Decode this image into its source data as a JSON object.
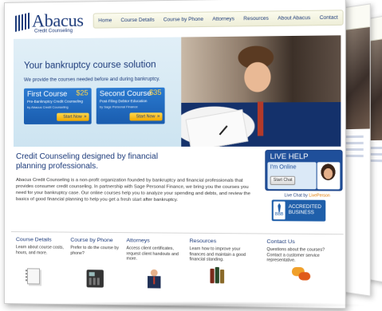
{
  "brand": {
    "name": "Abacus",
    "tagline": "Credit Counseling"
  },
  "nav": {
    "items": [
      "Home",
      "Course Details",
      "Course by Phone",
      "Attorneys",
      "Resources",
      "About Abacus",
      "Contact"
    ]
  },
  "hero": {
    "title": "Your bankruptcy course solution",
    "subtitle": "We provide the courses needed before and during bankruptcy.",
    "courses": [
      {
        "name": "First Course",
        "price": "$25",
        "desc": "Pre-Bankruptcy Credit Counseling",
        "by": "by Abacus Credit Counseling",
        "button": "Start Now"
      },
      {
        "name": "Second Course",
        "price": "$35",
        "desc": "Post-Filing Debtor Education",
        "by": "by Sage Personal Finance",
        "button": "Start Now"
      }
    ]
  },
  "main": {
    "title": "Credit Counseling designed by financial planning professionals.",
    "body": "Abacus Credit Counseling is a non-profit organization founded by bankruptcy and financial professionals that provides consumer credit counseling. In partnership with Sage Personal Finance, we bring you the courses you need for your bankruptcy case. Our online courses help you to analyze your spending and debts, and review the basics of good financial planning to help you get a fresh start after bankruptcy."
  },
  "live_help": {
    "title": "LIVE HELP",
    "status": "I'm Online",
    "chat_button": "Start Chat",
    "powered_prefix": "Live Chat by",
    "powered_brand": "LivePerson"
  },
  "bbb": {
    "logo": "BBB",
    "line1": "ACCREDITED",
    "line2": "BUSINESS"
  },
  "features": [
    {
      "title": "Course Details",
      "desc": "Learn about course costs, hours, and more.",
      "icon": "document-icon"
    },
    {
      "title": "Course by Phone",
      "desc": "Prefer to do the course by phone?",
      "icon": "phone-icon"
    },
    {
      "title": "Attorneys",
      "desc": "Access client certificates, request client handouts and more.",
      "icon": "attorney-icon"
    },
    {
      "title": "Resources",
      "desc": "Learn how to improve your finances and maintain a good financial standing.",
      "icon": "books-icon"
    },
    {
      "title": "Contact Us",
      "desc": "Questions about the courses? Contact a customer service representative.",
      "icon": "chat-bubbles-icon"
    }
  ],
  "back_pages": {
    "nav_fragment": "act"
  },
  "colors": {
    "brand_blue": "#1c3a7a",
    "accent_blue": "#1f5faa",
    "button_yellow": "#f0a800",
    "hero_bg": "#cde4f1"
  }
}
